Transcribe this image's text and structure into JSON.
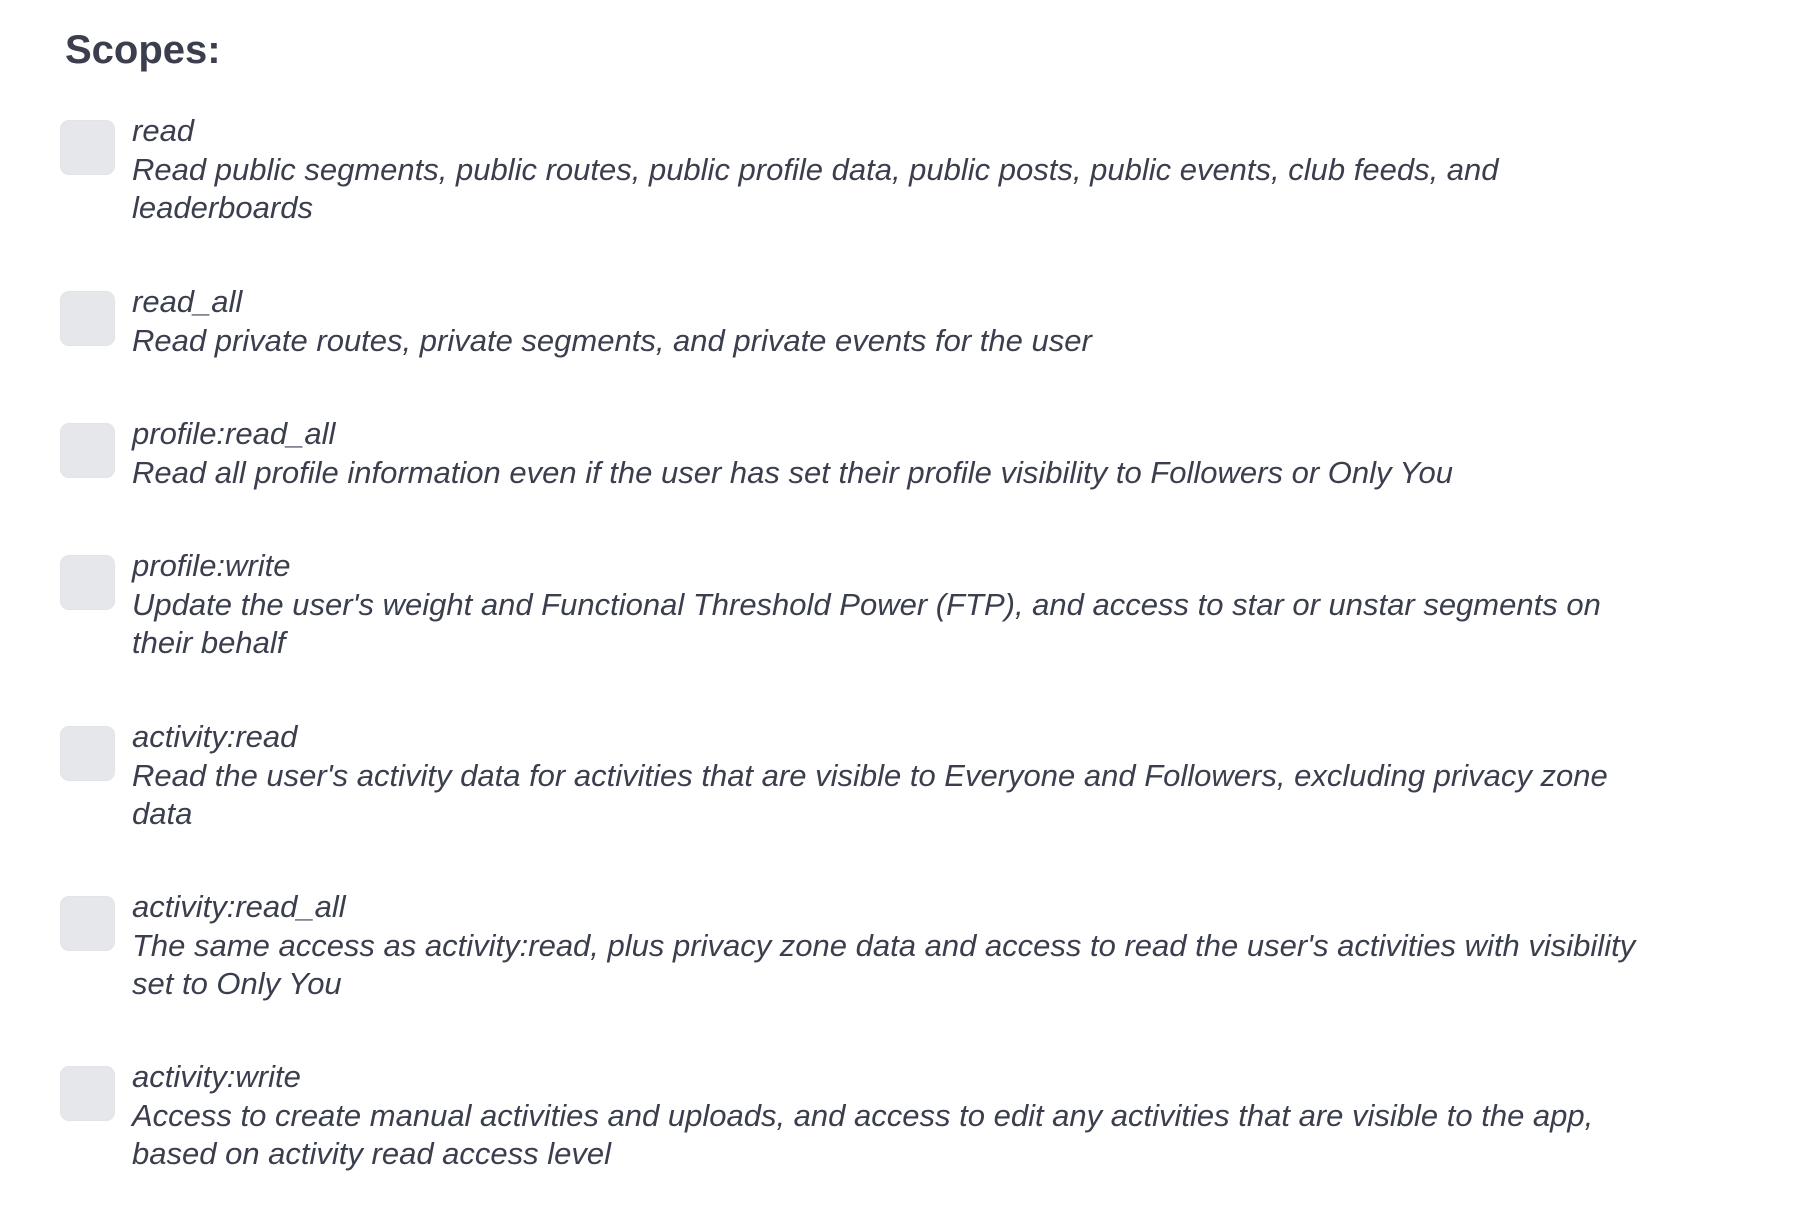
{
  "heading": "Scopes:",
  "scopes": [
    {
      "name": "read",
      "description": "Read public segments, public routes, public profile data, public posts, public events, club feeds, and leaderboards",
      "checked": false
    },
    {
      "name": "read_all",
      "description": "Read private routes, private segments, and private events for the user",
      "checked": false
    },
    {
      "name": "profile:read_all",
      "description": "Read all profile information even if the user has set their profile visibility to Followers or Only You",
      "checked": false
    },
    {
      "name": "profile:write",
      "description": "Update the user's weight and Functional Threshold Power (FTP), and access to star or unstar segments on their behalf",
      "checked": false
    },
    {
      "name": "activity:read",
      "description": "Read the user's activity data for activities that are visible to Everyone and Followers, excluding privacy zone data",
      "checked": false
    },
    {
      "name": "activity:read_all",
      "description": "The same access as activity:read, plus privacy zone data and access to read the user's activities with visibility set to Only You",
      "checked": false
    },
    {
      "name": "activity:write",
      "description": "Access to create manual activities and uploads, and access to edit any activities that are visible to the app, based on activity read access level",
      "checked": false
    }
  ]
}
